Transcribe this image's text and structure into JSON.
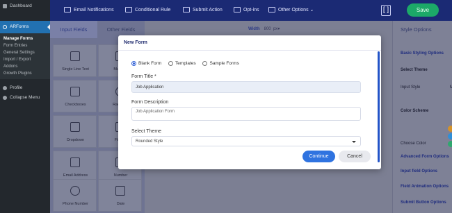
{
  "wp_sidebar": {
    "dashboard": "Dashboard",
    "arforms": "ARForms",
    "submenu": [
      "Manage Forms",
      "Form Entries",
      "General Settings",
      "Import / Export",
      "Addons",
      "Growth Plugins"
    ],
    "profile": "Profile",
    "collapse": "Collapse Menu"
  },
  "toolbar": {
    "email": "Email Notifications",
    "conditional": "Conditional Rule",
    "submit": "Submit Action",
    "optins": "Opt-ins",
    "other": "Other Options",
    "bracket": "[ ]",
    "save": "Save"
  },
  "field_panel": {
    "tabs": [
      "Input Fields",
      "Other Fields"
    ],
    "fields": [
      "Single Line Text",
      "Multiline",
      "Checkboxes",
      "Radio Bu",
      "Dropdown",
      "File Up",
      "Email Address",
      "Number",
      "Phone Number",
      "Date"
    ]
  },
  "canvas": {
    "width_label": "Width",
    "width_value": "800",
    "unit": "px"
  },
  "right_panel": {
    "title": "Style Options",
    "basic": "Basic Styling Options",
    "select_theme": "Select Theme",
    "input_style": "Input Style",
    "input_style_val": "M",
    "color_scheme": "Color Scheme",
    "choose_color": "Choose Color",
    "advanced": "Advanced Form Options",
    "input_field": "Input field Options",
    "animation": "Field Animation Options",
    "submit_btn": "Submit Button Options",
    "dot_colors": [
      "#d4922a",
      "#2f8fd8",
      "#2fa86e"
    ]
  },
  "modal": {
    "title": "New Form",
    "radio_options": [
      "Blank Form",
      "Templates",
      "Sample Forms"
    ],
    "form_title_label": "Form Title *",
    "form_title_value": "Job Application",
    "desc_label": "Form Description",
    "desc_value": "Job Application Form",
    "theme_label": "Select Theme",
    "theme_value": "Rounded Style",
    "continue": "Continue",
    "cancel": "Cancel"
  }
}
